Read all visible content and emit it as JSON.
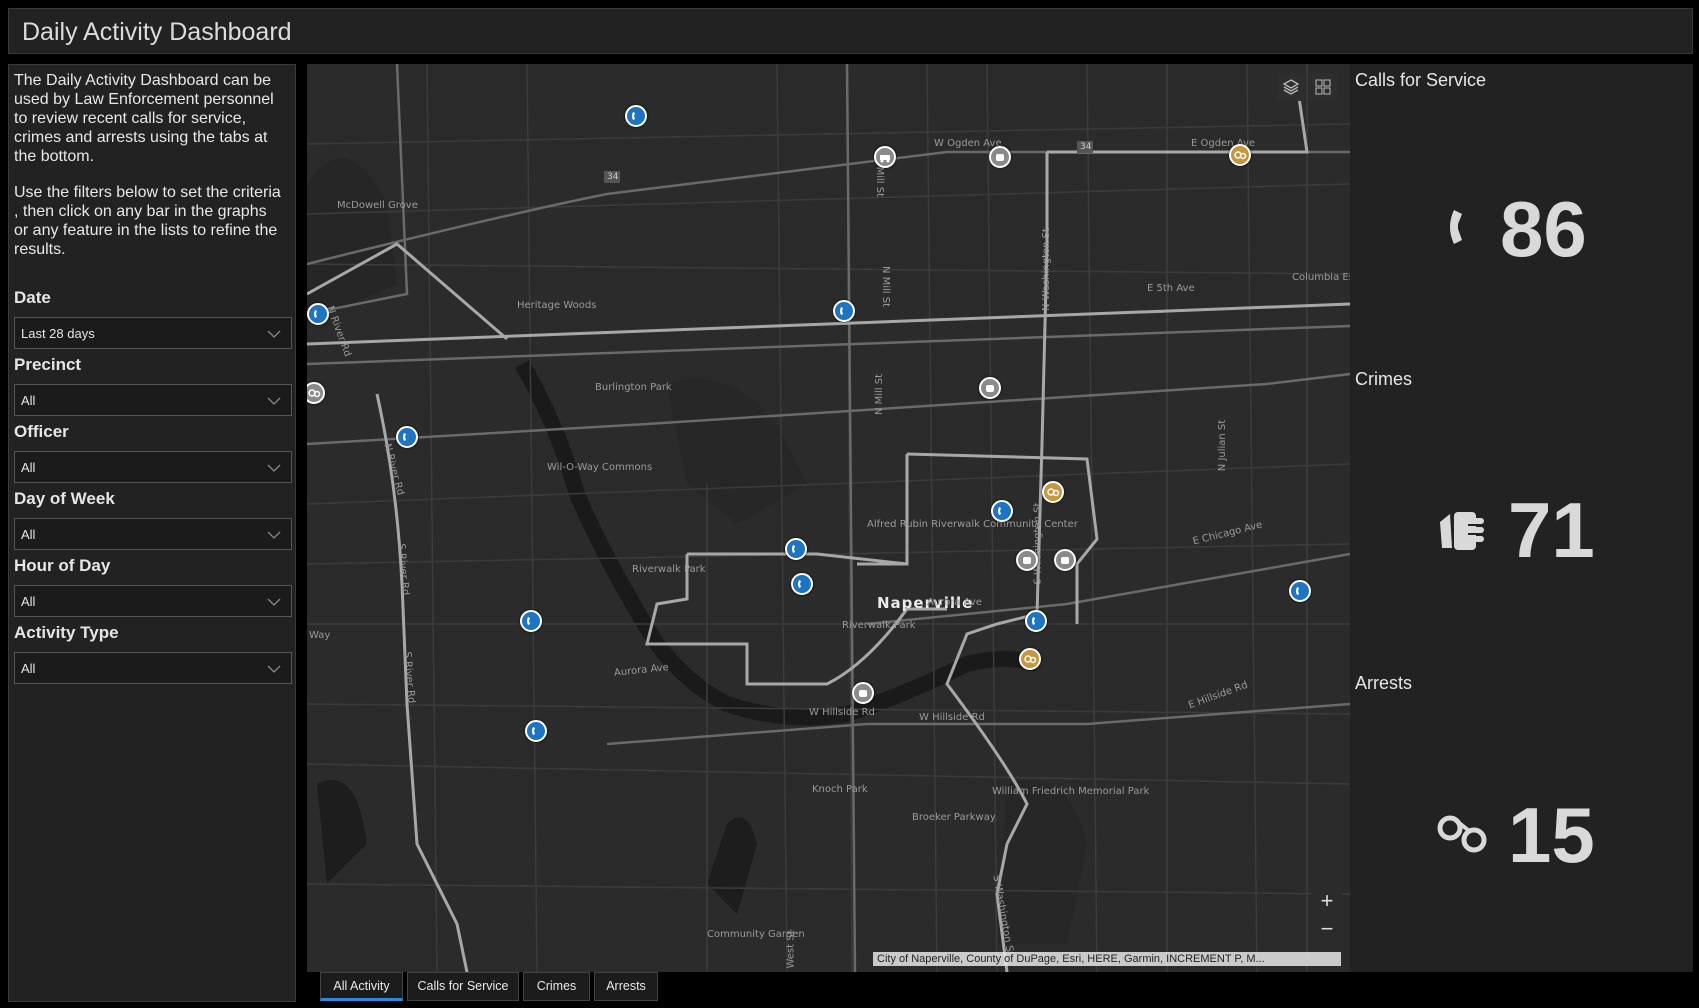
{
  "header": {
    "title": "Daily Activity Dashboard"
  },
  "sidebar": {
    "description_1": "The Daily Activity Dashboard can be used by Law Enforcement personnel to review recent calls for service, crimes and arrests using the tabs at the bottom.",
    "description_2": "Use the filters below to set the criteria , then click on any bar in the graphs or any feature in the lists to refine the results.",
    "filters": [
      {
        "label": "Date",
        "value": "Last 28 days"
      },
      {
        "label": "Precinct",
        "value": "All"
      },
      {
        "label": "Officer",
        "value": "All"
      },
      {
        "label": "Day of Week",
        "value": "All"
      },
      {
        "label": "Hour of Day",
        "value": "All"
      },
      {
        "label": "Activity Type",
        "value": "All"
      }
    ]
  },
  "map": {
    "labels": {
      "mcdowell": "McDowell Grove",
      "heritage": "Heritage Woods",
      "burlington": "Burlington Park",
      "willoway": "Wil-O-Way Commons",
      "riverwalk1": "Riverwalk Park",
      "alfred": "Alfred Rubin Riverwalk Community Center",
      "naperville": "Naperville",
      "riverwalk2": "Riverwalk Park",
      "knoch": "Knoch Park",
      "william": "William Friedrich Memorial Park",
      "broeker": "Broeker Parkway",
      "community": "Community Garden",
      "columbia": "Columbia Estates Park",
      "wogden": "W Ogden Ave",
      "eogden": "E Ogden Ave",
      "e5th": "E 5th Ave",
      "echicago": "E Chicago Ave",
      "aurora1": "Aurora Ave",
      "aurora2": "Aurora Ave",
      "whillside1": "W Hillside Rd",
      "whillside2": "W Hillside Rd",
      "ehillside": "E Hillside Rd",
      "nmill1": "N Mill St",
      "nmill2": "N Mill St",
      "nmill3": "N Mill St",
      "nwashington": "N Washington St",
      "swashington1": "S Washington St",
      "swashington2": "S Washington St",
      "njulian": "N Julian St",
      "nriver1": "N River Rd",
      "nriver2": "N River Rd",
      "sriver1": "S River Rd",
      "sriver2": "S River Rd",
      "west": "West St",
      "way": "Way",
      "r34a": "34",
      "r34b": "34"
    },
    "attribution": "City of Naperville, County of DuPage, Esri, HERE, Garmin, INCREMENT P, M...",
    "zoom_in": "+",
    "zoom_out": "−",
    "layers_icon": "layers-icon",
    "basemap_icon": "basemap-gallery-icon"
  },
  "tabs": [
    "All Activity",
    "Calls for Service",
    "Crimes",
    "Arrests"
  ],
  "indicators": {
    "calls": {
      "title": "Calls for Service",
      "value": "86",
      "icon": "phone-icon"
    },
    "crimes": {
      "title": "Crimes",
      "value": "71",
      "icon": "fist-icon"
    },
    "arrests": {
      "title": "Arrests",
      "value": "15",
      "icon": "handcuffs-icon"
    }
  },
  "colors": {
    "call_marker": "#1f74c2",
    "crime_marker": "#8a8a8a",
    "arrest_marker": "#c8963e",
    "tab_active": "#2b8adf"
  }
}
